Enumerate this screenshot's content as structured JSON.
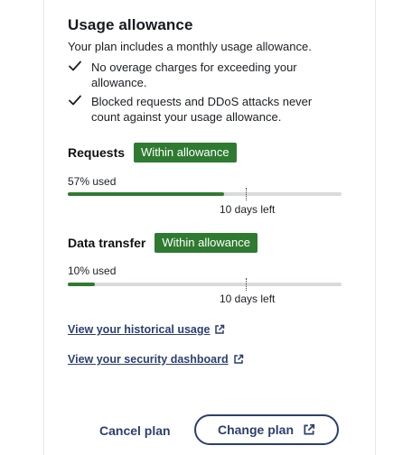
{
  "usage": {
    "title": "Usage allowance",
    "subtitle": "Your plan includes a monthly usage allowance.",
    "bullets": [
      {
        "icon": "checkmark-icon",
        "text": "No overage charges for exceeding your allowance."
      },
      {
        "icon": "checkmark-icon",
        "text": "Blocked requests and DDoS attacks never count against your usage allowance."
      }
    ]
  },
  "requests": {
    "title": "Requests",
    "badge": "Within allowance",
    "used_label": "57% used",
    "used_fraction": 0.57,
    "days_left": "10 days left"
  },
  "data_transfer": {
    "title": "Data transfer",
    "badge": "Within allowance",
    "used_label": "10% used",
    "used_fraction": 0.1,
    "days_left": "10 days left"
  },
  "links": {
    "historical": "View your historical usage",
    "security": "View your security dashboard",
    "icon": "external-link-icon"
  },
  "actions": {
    "cancel": "Cancel plan",
    "change": "Change plan",
    "change_icon": "external-link-icon"
  },
  "colors": {
    "accent": "#2f7a31",
    "link": "#2c3f6e",
    "track": "#d9dadb"
  }
}
